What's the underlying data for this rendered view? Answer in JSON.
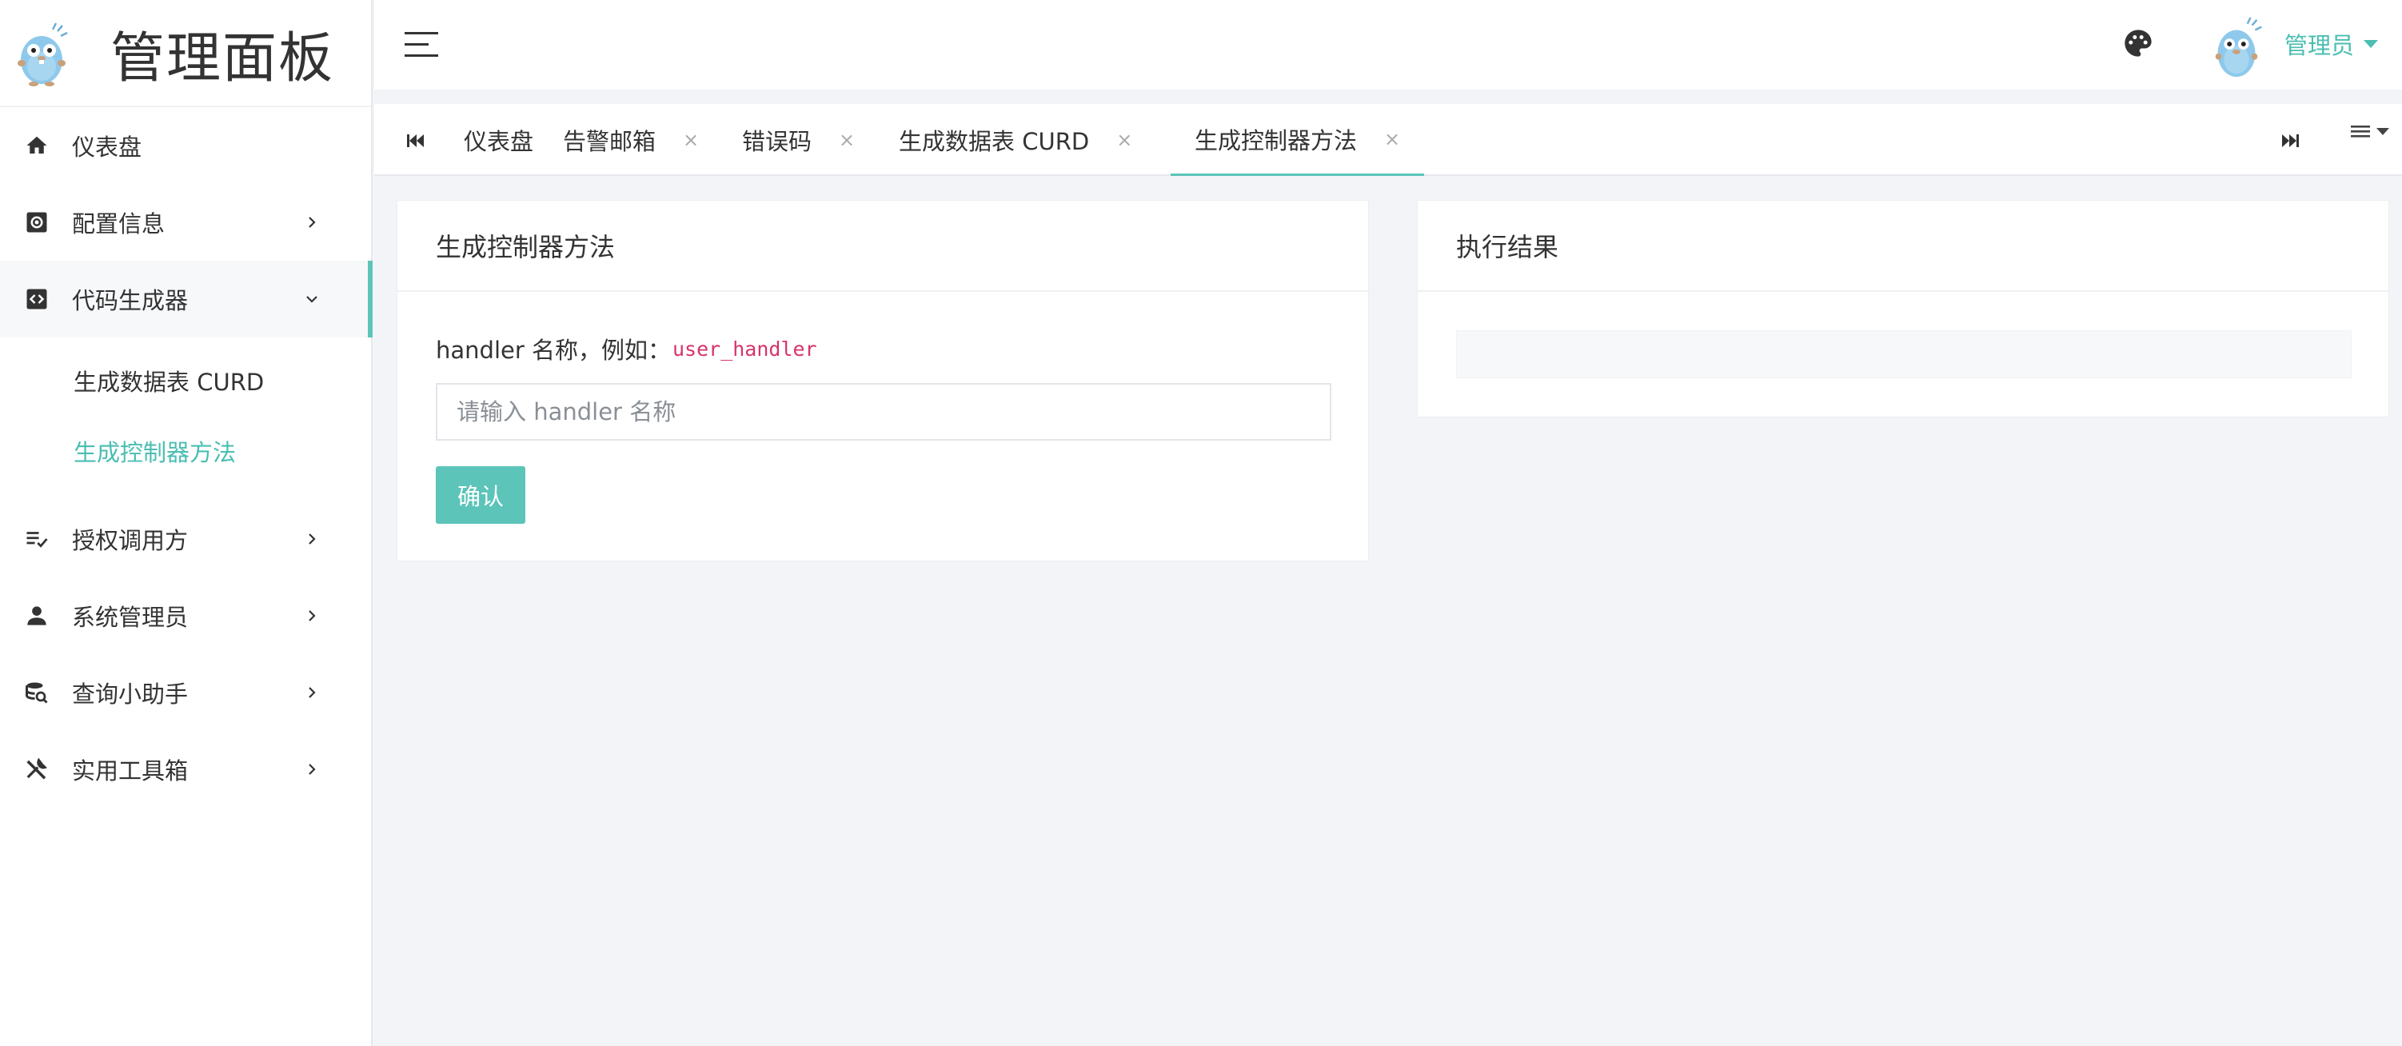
{
  "brand": {
    "title": "管理面板"
  },
  "sidebar": {
    "items": [
      {
        "label": "仪表盘",
        "icon": "home-icon"
      },
      {
        "label": "配置信息",
        "icon": "gear-box-icon"
      },
      {
        "label": "代码生成器",
        "icon": "code-box-icon",
        "children": [
          "生成数据表 CURD",
          "生成控制器方法"
        ]
      },
      {
        "label": "授权调用方",
        "icon": "list-check-icon"
      },
      {
        "label": "系统管理员",
        "icon": "user-icon"
      },
      {
        "label": "查询小助手",
        "icon": "database-search-icon"
      },
      {
        "label": "实用工具箱",
        "icon": "tools-icon"
      }
    ]
  },
  "header": {
    "user": "管理员"
  },
  "tabs": [
    {
      "label": "仪表盘"
    },
    {
      "label": "告警邮箱",
      "close": "×"
    },
    {
      "label": "错误码",
      "close": "×"
    },
    {
      "label": "生成数据表 CURD",
      "close": "×"
    },
    {
      "label": "生成控制器方法",
      "close": "×"
    }
  ],
  "form_card": {
    "title": "生成控制器方法",
    "label": "handler 名称，例如：",
    "example": "user_handler",
    "placeholder": "请输入 handler 名称",
    "submit": "确认"
  },
  "result_card": {
    "title": "执行结果"
  },
  "colors": {
    "accent": "#5cc4b9",
    "accent_text": "#4bbeb2",
    "code": "#d6336c"
  }
}
